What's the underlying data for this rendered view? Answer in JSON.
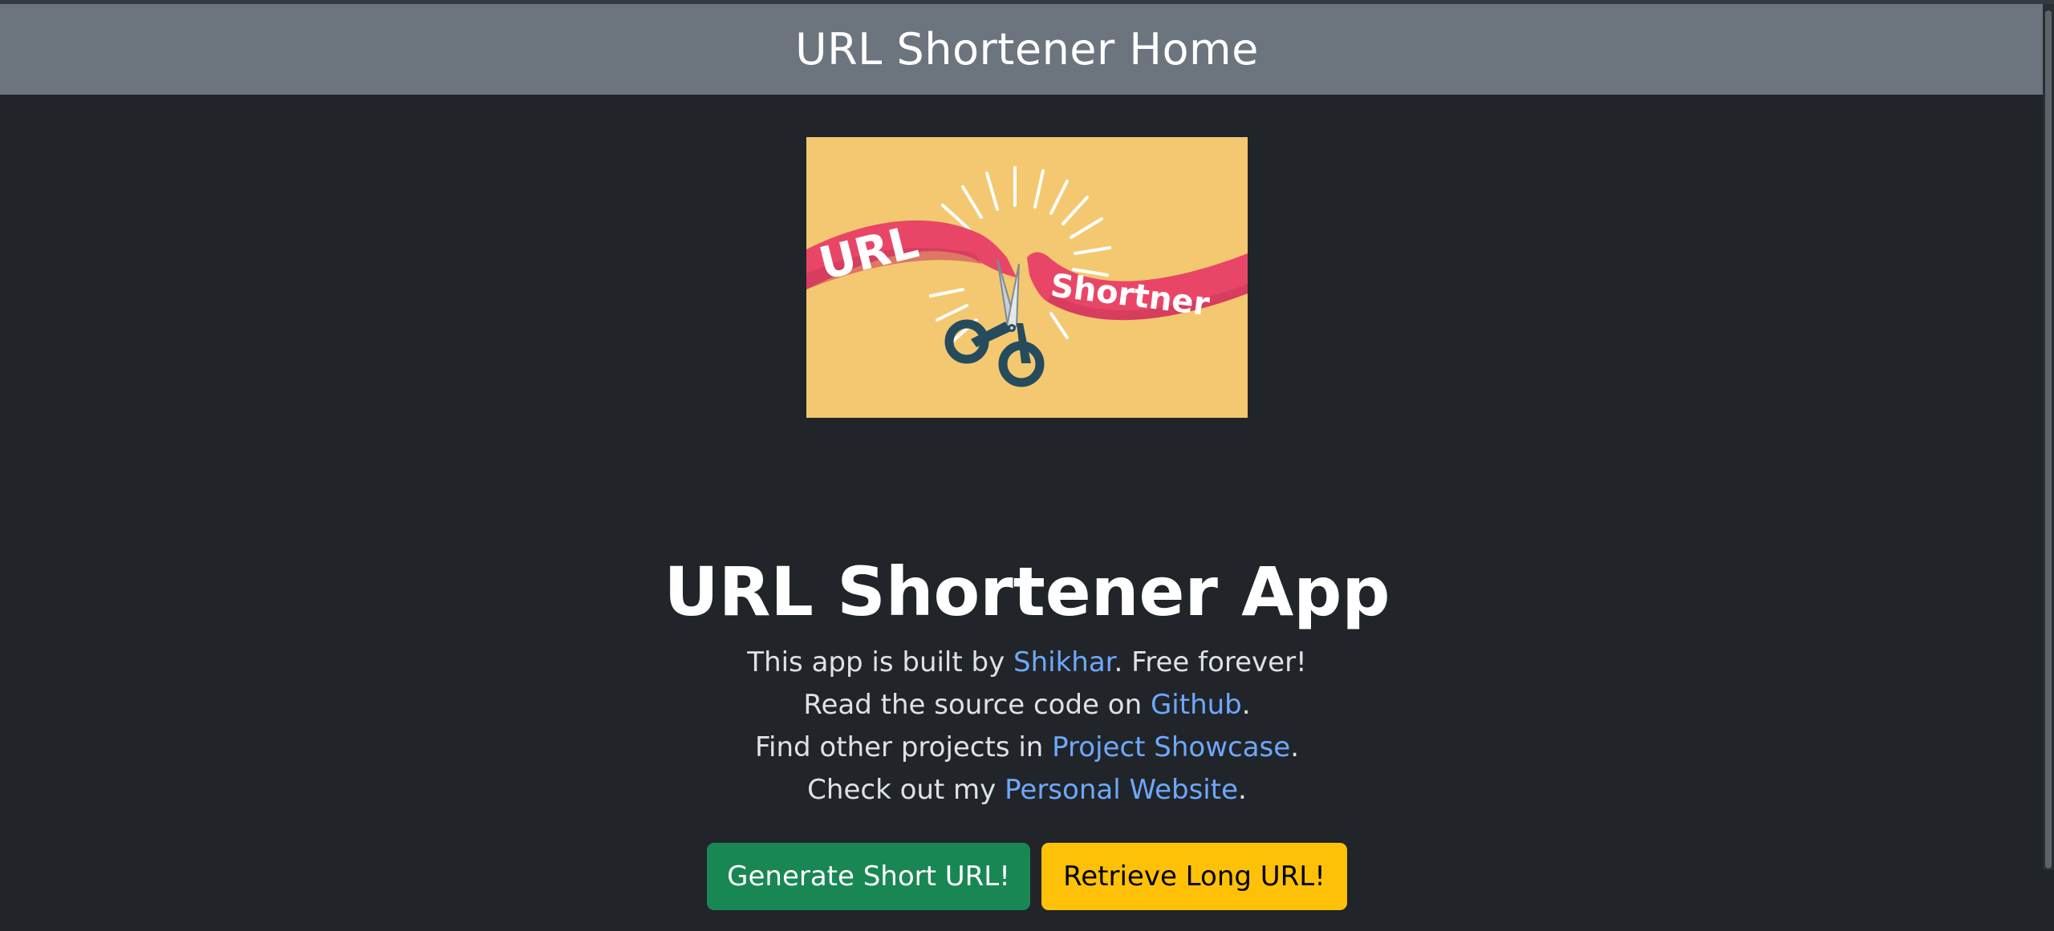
{
  "header": {
    "title": "URL Shortener Home"
  },
  "logo": {
    "word_left": "URL",
    "word_right": "Shortner"
  },
  "main": {
    "title": "URL Shortener App",
    "lines": [
      {
        "before": "This app is built by ",
        "link": "Shikhar",
        "after": ". Free forever!"
      },
      {
        "before": "Read the source code on ",
        "link": "Github",
        "after": "."
      },
      {
        "before": "Find other projects in ",
        "link": "Project Showcase",
        "after": "."
      },
      {
        "before": "Check out my ",
        "link": "Personal Website",
        "after": "."
      }
    ],
    "buttons": {
      "generate": "Generate Short URL!",
      "retrieve": "Retrieve Long URL!"
    }
  },
  "colors": {
    "background": "#212529",
    "header": "#6c757d",
    "link": "#6ea8fe",
    "generate_button": "#198754",
    "retrieve_button": "#ffc107",
    "logo_background": "#f4c870",
    "ribbon": "#e94667"
  },
  "icons": {
    "scissors": "scissors-icon"
  }
}
